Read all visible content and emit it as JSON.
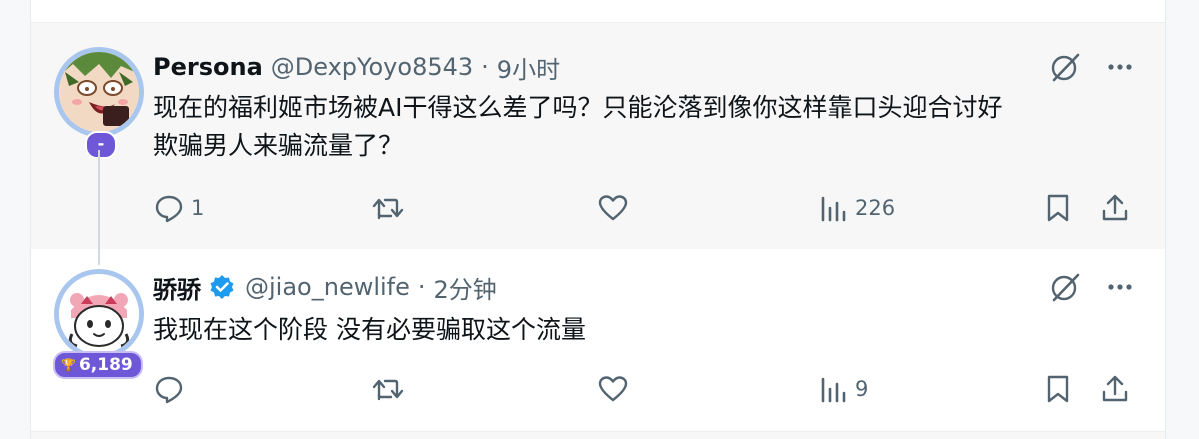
{
  "parent_tweet": {
    "display_name": "Persona",
    "handle": "@DexpYoyo8543",
    "separator": "·",
    "time": "9小时",
    "badge": "-",
    "text": "现在的福利姬市场被AI干得这么差了吗？只能沦落到像你这样靠口头迎合讨好\n欺骗男人来骗流量了？",
    "reply_count": "1",
    "retweet_count": "",
    "like_count": "",
    "view_count": "226"
  },
  "reply_tweet": {
    "display_name": "骄骄",
    "handle": "@jiao_newlife",
    "separator": "·",
    "time": "2分钟",
    "badge_trophy": "🏆",
    "badge_score": "6,189",
    "verified": true,
    "text": "我现在这个阶段 没有必要骗取这个流量",
    "reply_count": "",
    "retweet_count": "",
    "like_count": "",
    "view_count": "9"
  },
  "colors": {
    "verified_blue": "#1d9bf0",
    "badge_purple": "#6f58d8",
    "icon_gray": "#536471",
    "avatar_ring": "#a9c6ee"
  },
  "icons": [
    "grok-icon",
    "more-icon",
    "reply-icon",
    "retweet-icon",
    "like-icon",
    "views-icon",
    "bookmark-icon",
    "share-icon",
    "verified-icon",
    "trophy-icon"
  ]
}
